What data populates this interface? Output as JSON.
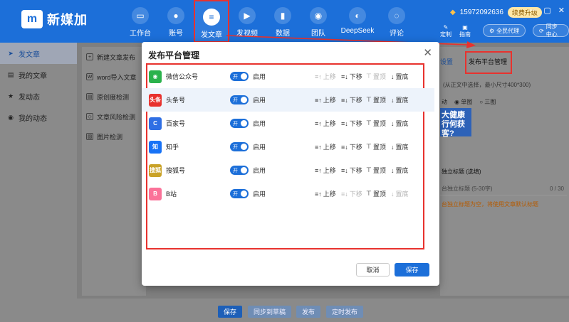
{
  "app": {
    "logo_text": "新媒加"
  },
  "header": {
    "nav": [
      {
        "label": "工作台",
        "icon": "monitor-icon",
        "glyph": "▭"
      },
      {
        "label": "账号",
        "icon": "user-icon",
        "glyph": "●"
      },
      {
        "label": "发文章",
        "icon": "document-icon",
        "glyph": "≡"
      },
      {
        "label": "发视频",
        "icon": "video-icon",
        "glyph": "▶"
      },
      {
        "label": "数据",
        "icon": "bar-chart-icon",
        "glyph": "▮"
      },
      {
        "label": "团队",
        "icon": "team-icon",
        "glyph": "◉"
      },
      {
        "label": "DeepSeek",
        "icon": "whale-icon",
        "glyph": "◐"
      },
      {
        "label": "评论",
        "icon": "comment-icon",
        "glyph": "◌"
      }
    ],
    "phone": "15972092636",
    "vip_label": "续费升级",
    "tools": {
      "custom": "定制",
      "guide": "指南",
      "agent": "全民代理",
      "sync": "同步中心"
    }
  },
  "sidebar": {
    "items": [
      {
        "label": "发文章",
        "icon": "send-icon",
        "glyph": "➤"
      },
      {
        "label": "我的文章",
        "icon": "file-icon",
        "glyph": "▤"
      },
      {
        "label": "发动态",
        "icon": "star-icon",
        "glyph": "★"
      },
      {
        "label": "我的动态",
        "icon": "record-icon",
        "glyph": "◉"
      }
    ]
  },
  "subnav": {
    "items": [
      {
        "label": "新建文章发布",
        "glyph": "+"
      },
      {
        "label": "word导入文章",
        "glyph": "W"
      },
      {
        "label": "原创度检测",
        "glyph": "▤"
      },
      {
        "label": "文章风险检测",
        "glyph": "◇"
      },
      {
        "label": "图片检测",
        "glyph": "▨"
      }
    ]
  },
  "right_panel": {
    "tab_a": "设置",
    "tab_b": "发布平台管理",
    "hint": "(从正文中选择，最小尺寸400*300)",
    "radios": [
      "动",
      "单图",
      "三图"
    ],
    "banner": "大健康行何获客?",
    "title_label": "独立标题 (选填)",
    "input_placeholder": "台独立标题 (5-30字)",
    "input_count": "0 / 30",
    "warning": "台独立标题为空，将使用文章默认标题"
  },
  "bottom": {
    "save": "保存",
    "sync_draft": "同步到草稿",
    "publish": "发布",
    "schedule": "定时发布"
  },
  "modal": {
    "title": "发布平台管理",
    "cancel": "取消",
    "save": "保存",
    "actions": {
      "up": "上移",
      "down": "下移",
      "top": "置顶",
      "bottom": "置底"
    },
    "toggle_on": "开",
    "enabled_label": "启用",
    "platforms": [
      {
        "name": "微信公众号",
        "icon": "wechat-icon",
        "glyph": "◉",
        "color": "#2bb24c"
      },
      {
        "name": "头条号",
        "icon": "toutiao-icon",
        "glyph": "头条",
        "color": "#e8322e"
      },
      {
        "name": "百家号",
        "icon": "baijiahao-icon",
        "glyph": "C",
        "color": "#2f6fe4"
      },
      {
        "name": "知乎",
        "icon": "zhihu-icon",
        "glyph": "知",
        "color": "#1772f6"
      },
      {
        "name": "搜狐号",
        "icon": "sohu-icon",
        "glyph": "搜狐",
        "color": "#c9a227"
      },
      {
        "name": "B站",
        "icon": "bilibili-icon",
        "glyph": "B",
        "color": "#fb7299"
      }
    ]
  }
}
